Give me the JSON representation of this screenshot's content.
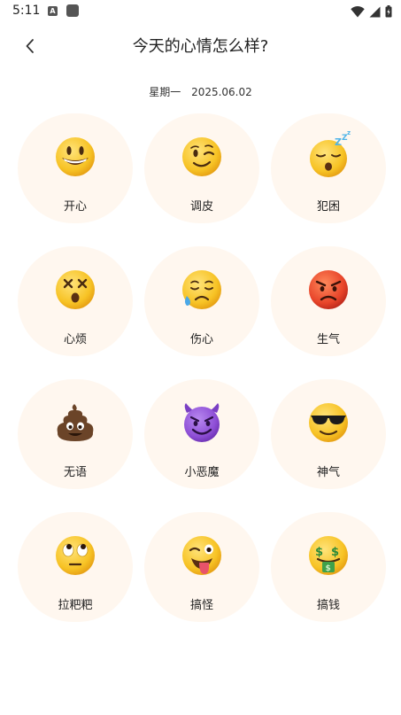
{
  "status_bar": {
    "time": "5:11",
    "left_icons": [
      "a-badge-icon",
      "app-square-icon"
    ],
    "right_icons": [
      "wifi-icon",
      "signal-icon",
      "battery-icon"
    ]
  },
  "header": {
    "title": "今天的心情怎么样?",
    "back_icon": "chevron-left-icon"
  },
  "date": {
    "weekday": "星期一",
    "date": "2025.06.02"
  },
  "moods": [
    {
      "label": "开心",
      "emoji": "grinning-face"
    },
    {
      "label": "调皮",
      "emoji": "winking-face"
    },
    {
      "label": "犯困",
      "emoji": "sleeping-face"
    },
    {
      "label": "心烦",
      "emoji": "dizzy-face"
    },
    {
      "label": "伤心",
      "emoji": "sad-sweat-face"
    },
    {
      "label": "生气",
      "emoji": "angry-face"
    },
    {
      "label": "无语",
      "emoji": "pile-of-poo"
    },
    {
      "label": "小恶魔",
      "emoji": "smiling-devil"
    },
    {
      "label": "神气",
      "emoji": "sunglasses-face"
    },
    {
      "label": "拉粑粑",
      "emoji": "eye-roll-face"
    },
    {
      "label": "搞怪",
      "emoji": "tongue-wink-face"
    },
    {
      "label": "搞钱",
      "emoji": "money-mouth-face"
    }
  ],
  "colors": {
    "card_bg": "#fff7ef",
    "face_yellow": "#f7c325",
    "face_red": "#e8452a",
    "devil_purple": "#8e4fd6",
    "poo_brown": "#6b4428"
  }
}
